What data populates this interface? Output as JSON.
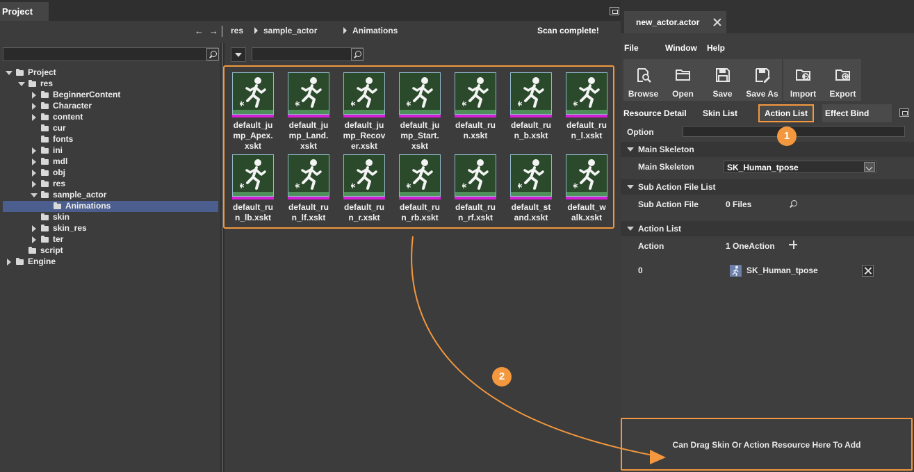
{
  "project": {
    "tab_title": "Project",
    "scan_status": "Scan complete!",
    "breadcrumb": [
      "res",
      "sample_actor",
      "Animations"
    ],
    "tree": [
      {
        "label": "Project",
        "depth": 0,
        "expander": "down"
      },
      {
        "label": "res",
        "depth": 1,
        "expander": "down"
      },
      {
        "label": "BeginnerContent",
        "depth": 2,
        "expander": "right"
      },
      {
        "label": "Character",
        "depth": 2,
        "expander": "right"
      },
      {
        "label": "content",
        "depth": 2,
        "expander": "right"
      },
      {
        "label": "cur",
        "depth": 2,
        "expander": "none"
      },
      {
        "label": "fonts",
        "depth": 2,
        "expander": "none"
      },
      {
        "label": "ini",
        "depth": 2,
        "expander": "right"
      },
      {
        "label": "mdl",
        "depth": 2,
        "expander": "right"
      },
      {
        "label": "obj",
        "depth": 2,
        "expander": "right"
      },
      {
        "label": "res",
        "depth": 2,
        "expander": "right"
      },
      {
        "label": "sample_actor",
        "depth": 2,
        "expander": "down"
      },
      {
        "label": "Animations",
        "depth": 3,
        "expander": "none",
        "selected": true,
        "open_folder": true
      },
      {
        "label": "skin",
        "depth": 2,
        "expander": "none"
      },
      {
        "label": "skin_res",
        "depth": 2,
        "expander": "right"
      },
      {
        "label": "ter",
        "depth": 2,
        "expander": "right"
      },
      {
        "label": "script",
        "depth": 1,
        "expander": "none"
      },
      {
        "label": "Engine",
        "depth": 0,
        "expander": "right"
      }
    ],
    "assets": [
      "default_ju\nmp_Apex.\nxskt",
      "default_ju\nmp_Land.\nxskt",
      "default_ju\nmp_Recov\ner.xskt",
      "default_ju\nmp_Start.\nxskt",
      "default_ru\nn.xskt",
      "default_ru\nn_b.xskt",
      "default_ru\nn_l.xskt",
      "default_ru\nn_lb.xskt",
      "default_ru\nn_lf.xskt",
      "default_ru\nn_r.xskt",
      "default_ru\nn_rb.xskt",
      "default_ru\nn_rf.xskt",
      "default_st\nand.xskt",
      "default_w\nalk.xskt"
    ]
  },
  "editor": {
    "tab_title": "new_actor.actor",
    "menu": [
      "File",
      "Window",
      "Help"
    ],
    "toolbar": {
      "browse": "Browse",
      "open": "Open",
      "save": "Save",
      "save_as": "Save As",
      "import": "Import",
      "export": "Export"
    },
    "tabs": {
      "resource_detail": "Resource Detail",
      "skin_list": "Skin List",
      "action_list": "Action List",
      "effect_bind": "Effect Bind"
    },
    "option_label": "Option",
    "main_skeleton": {
      "section": "Main Skeleton",
      "label": "Main Skeleton",
      "value": "SK_Human_tpose"
    },
    "sub_action": {
      "section": "Sub Action File List",
      "label": "Sub Action File",
      "value": "0 Files"
    },
    "action_list": {
      "section": "Action List",
      "label": "Action",
      "value": "1 OneAction",
      "entry_index": "0",
      "entry_value": "SK_Human_tpose"
    },
    "drop_hint": "Can Drag Skin Or Action Resource Here To Add"
  },
  "annotations": {
    "badge_1": "1",
    "badge_2": "2",
    "accent_color": "#f3983e"
  }
}
